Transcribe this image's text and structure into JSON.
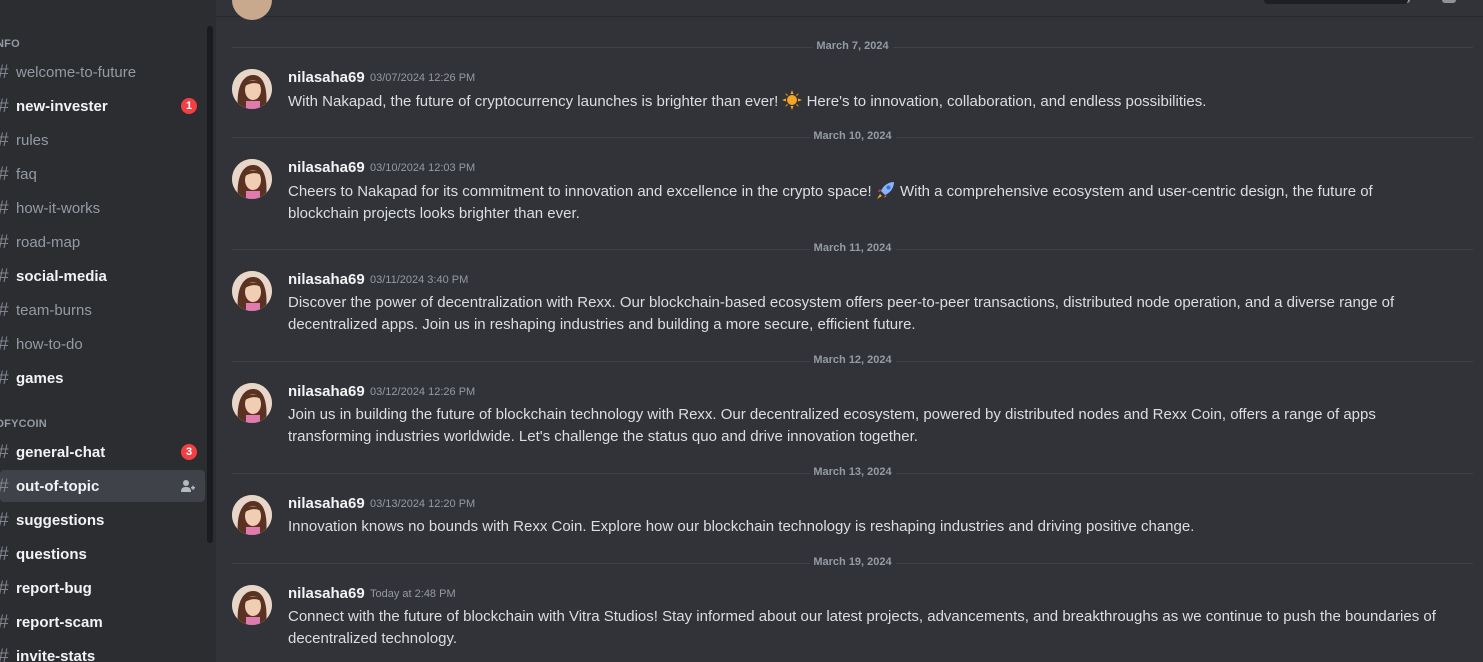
{
  "sidebar": {
    "categories": [
      {
        "label": "NFO"
      },
      {
        "label": "DFYCOIN"
      }
    ],
    "channels": [
      {
        "name": "welcome-to-future"
      },
      {
        "name": "new-invester",
        "badge": "1"
      },
      {
        "name": "rules"
      },
      {
        "name": "faq"
      },
      {
        "name": "how-it-works"
      },
      {
        "name": "road-map"
      },
      {
        "name": "social-media"
      },
      {
        "name": "team-burns"
      },
      {
        "name": "how-to-do"
      },
      {
        "name": "games"
      },
      {
        "name": "general-chat",
        "badge": "3"
      },
      {
        "name": "out-of-topic"
      },
      {
        "name": "suggestions"
      },
      {
        "name": "questions"
      },
      {
        "name": "report-bug"
      },
      {
        "name": "report-scam"
      },
      {
        "name": "invite-stats"
      }
    ]
  },
  "messages": {
    "dividers": [
      "March 7, 2024",
      "March 10, 2024",
      "March 11, 2024",
      "March 12, 2024",
      "March 13, 2024",
      "March 19, 2024"
    ],
    "items": [
      {
        "author": "nilasaha69",
        "time": "03/07/2024 12:26 PM",
        "text_before": "With Nakapad, the future of cryptocurrency launches is brighter than ever!",
        "emoji": "sun-emoji",
        "text_after": "Here's to innovation, collaboration, and endless possibilities."
      },
      {
        "author": "nilasaha69",
        "time": "03/10/2024 12:03 PM",
        "text_before": "Cheers to Nakapad for its commitment to innovation and excellence in the crypto space!",
        "emoji": "rocket-emoji",
        "text_after": "With a comprehensive ecosystem and user-centric design, the future of blockchain projects looks brighter than ever."
      },
      {
        "author": "nilasaha69",
        "time": "03/11/2024 3:40 PM",
        "text": "Discover the power of decentralization with Rexx. Our blockchain-based ecosystem offers peer-to-peer transactions, distributed node operation, and a diverse range of decentralized apps. Join us in reshaping industries and building a more secure, efficient future."
      },
      {
        "author": "nilasaha69",
        "time": "03/12/2024 12:26 PM",
        "text": "Join us in building the future of blockchain technology with Rexx. Our decentralized ecosystem, powered by distributed nodes and Rexx Coin, offers a range of apps transforming industries worldwide. Let's challenge the status quo and drive innovation together."
      },
      {
        "author": "nilasaha69",
        "time": "03/13/2024 12:20 PM",
        "text": "Innovation knows no bounds with Rexx Coin. Explore how our blockchain technology is reshaping industries and driving positive change."
      },
      {
        "author": "nilasaha69",
        "time": "Today at 2:48 PM",
        "text": "Connect with the future of blockchain with Vitra Studios! Stay informed about our latest projects, advancements, and breakthroughs as we continue to push the boundaries of decentralized technology."
      }
    ]
  },
  "colors": {
    "background": "#313338",
    "sidebar": "#2b2d31",
    "badge": "#f23f43",
    "active_channel": "#404249"
  }
}
